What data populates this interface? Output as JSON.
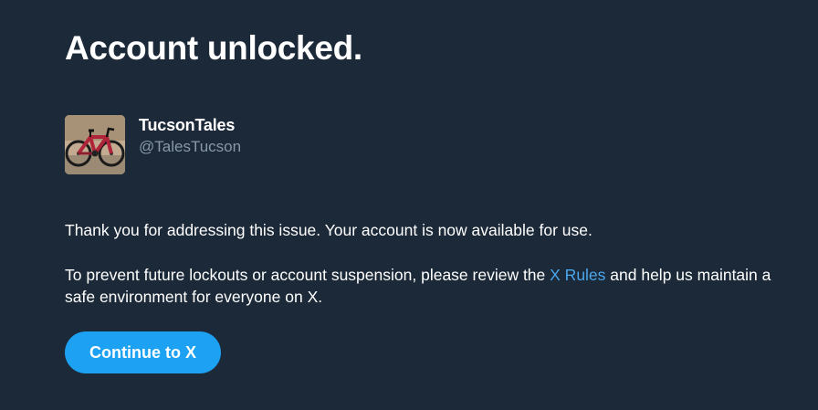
{
  "page": {
    "title": "Account unlocked."
  },
  "profile": {
    "display_name": "TucsonTales",
    "handle": "@TalesTucson",
    "avatar_icon": "bicycle-photo-avatar"
  },
  "message": {
    "paragraph1": "Thank you for addressing this issue. Your account is now available for use.",
    "paragraph2_before_link": "To prevent future lockouts or account suspension, please review the ",
    "paragraph2_link": "X Rules",
    "paragraph2_after_link": " and help us maintain a safe environment for everyone on X."
  },
  "actions": {
    "continue_label": "Continue to X"
  },
  "colors": {
    "background": "#1c2938",
    "accent": "#1da1f2",
    "link": "#4aa7ee",
    "secondary_text": "#8899a6"
  }
}
